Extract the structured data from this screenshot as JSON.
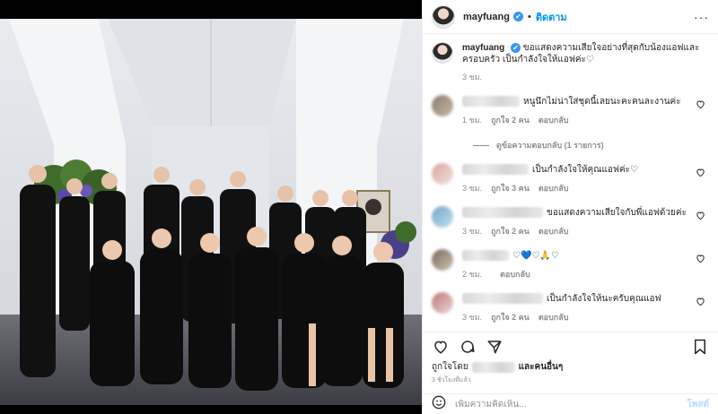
{
  "header": {
    "username": "mayfuang",
    "separator": "•",
    "follow_label": "ติดตาม",
    "more_label": "···",
    "verified_icon": "✔"
  },
  "caption": {
    "username": "mayfuang",
    "text": "ขอแสดงความเสียใจอย่างที่สุดกับน้องแอฟและครอบครัว เป็นกำลังใจให้แอฟค่ะ♡",
    "time": "3 ชม."
  },
  "comments": [
    {
      "text": "หนูนึกไม่น่าใส่ชุดนี้เลยนะคะคนละงานค่ะ",
      "time": "1 ชม.",
      "likes": "ถูกใจ 2 คน",
      "reply": "ตอบกลับ",
      "colors": [
        "#8a7a6a",
        "#c9b9a6"
      ],
      "name_w": 64
    },
    {
      "text": "เป็นกำลังใจให้คุณแอฟค่ะ♡",
      "time": "3 ชม.",
      "likes": "ถูกใจ 3 คน",
      "reply": "ตอบกลับ",
      "colors": [
        "#d9a6a0",
        "#f2e0dc"
      ],
      "name_w": 74
    },
    {
      "text": "ขอแสดงความเสียใจกับพี่แอฟด้วยค่ะ",
      "time": "3 ชม.",
      "likes": "ถูกใจ 2 คน",
      "reply": "ตอบกลับ",
      "colors": [
        "#6fa6c7",
        "#c6e0ef"
      ],
      "name_w": 90
    },
    {
      "text": "♡💙♡🙏♡",
      "time": "2 ชม.",
      "likes": "",
      "reply": "ตอบกลับ",
      "colors": [
        "#7a6a5a",
        "#cfc2b4"
      ],
      "name_w": 52
    },
    {
      "text": "เป็นกำลังใจให้นะครับคุณแอฟ",
      "time": "3 ชม.",
      "likes": "ถูกใจ 2 คน",
      "reply": "ตอบกลับ",
      "colors": [
        "#b97878",
        "#f0d6d6"
      ],
      "name_w": 90
    },
    {
      "text": "🖤🖤🖤🖤🖤",
      "time": "",
      "likes": "",
      "reply": "",
      "colors": [
        "#6a8a6a",
        "#c2d8c2"
      ],
      "name_w": 56
    }
  ],
  "view_replies": "ดูข้อความตอบกลับ (1 รายการ)",
  "actions": {
    "like_icon": "heart-outline",
    "comment_icon": "comment-bubble",
    "share_icon": "paper-plane",
    "save_icon": "bookmark"
  },
  "likes": {
    "prefix": "ถูกใจโดย",
    "suffix": "และคนอื่นๆ"
  },
  "post_time": "3 ชั่วโมงที่แล้ว",
  "add_comment": {
    "placeholder": "เพิ่มความคิดเห็น...",
    "post_label": "โพสต์",
    "emoji_icon": "smiley"
  },
  "colors": {
    "accent": "#0095f6",
    "verified": "#3897f0",
    "muted": "#8e8e8e",
    "post_disabled": "#b3dbff"
  }
}
